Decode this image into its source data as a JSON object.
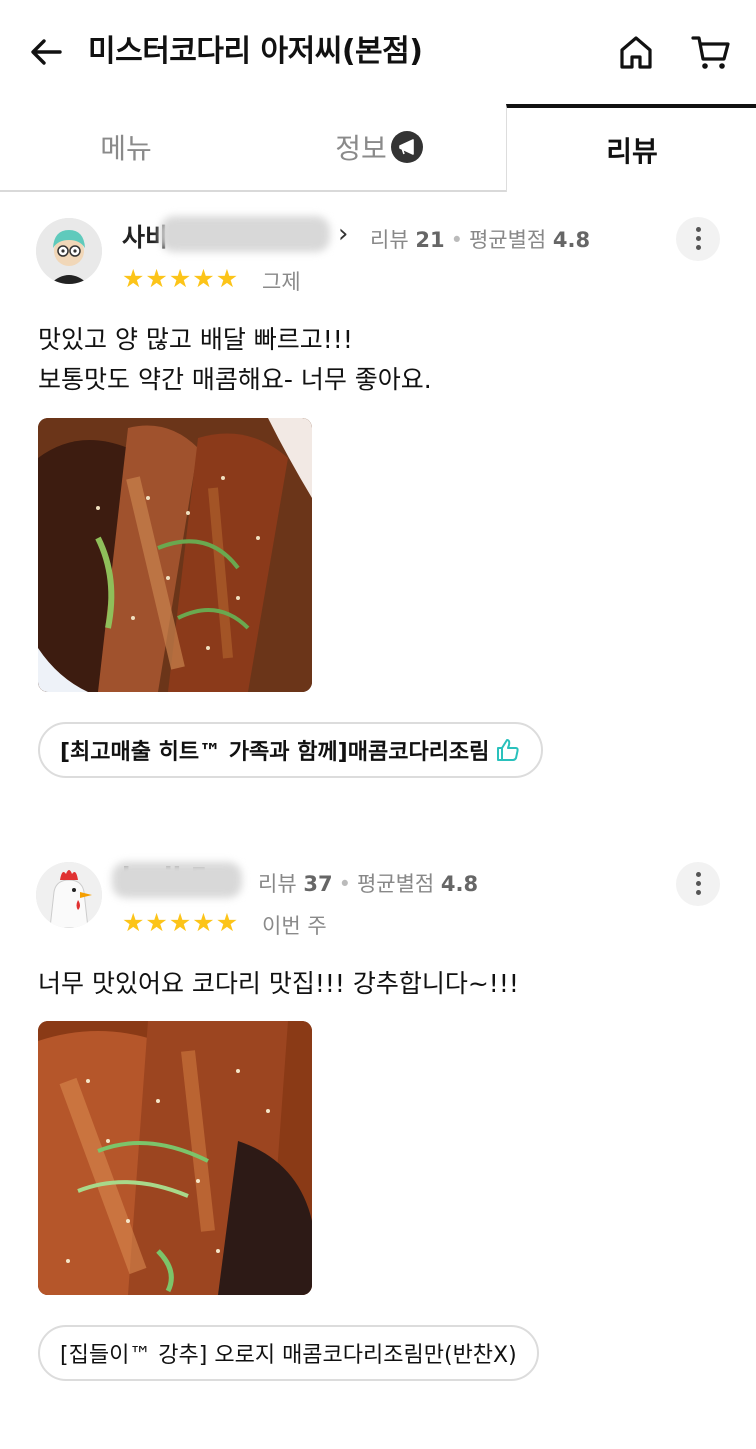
{
  "header": {
    "title": "미스터코다리 아저씨(본점)",
    "icons": [
      "back-arrow-icon",
      "home-icon",
      "cart-icon"
    ]
  },
  "tabs": [
    {
      "label": "메뉴",
      "active": false
    },
    {
      "label": "정보",
      "active": false,
      "badge": "ad-icon"
    },
    {
      "label": "리뷰",
      "active": true
    }
  ],
  "reviews": [
    {
      "username_visible": "사비",
      "review_count_label": "리뷰",
      "review_count": "21",
      "avg_label": "평균별점",
      "avg_rating": "4.8",
      "stars": 5,
      "when": "그제",
      "text": "맛있고 양 많고 배달 빠르고!!!\n보통맛도 약간 매콤해요- 너무 좋아요.",
      "menu": "[최고매출 히트™ 가족과 함께]매콤코다리조림",
      "menu_icon": "thumbs-up-icon"
    },
    {
      "username_visible": "lovih5",
      "review_count_label": "리뷰",
      "review_count": "37",
      "avg_label": "평균별점",
      "avg_rating": "4.8",
      "stars": 5,
      "when": "이번 주",
      "text": "너무 맛있어요 코다리 맛집!!! 강추합니다~!!!",
      "menu": "[집들이™ 강추] 오로지 매콤코다리조림만(반찬X)"
    }
  ],
  "colors": {
    "star": "#fcc419",
    "thumb": "#2ac1bc",
    "active_tab_border": "#111111"
  }
}
